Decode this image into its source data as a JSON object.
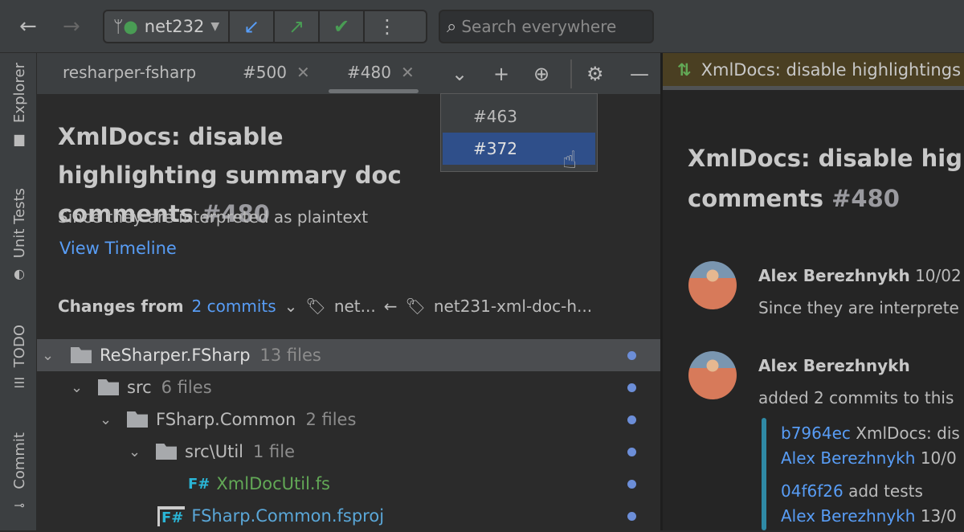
{
  "toolbar": {
    "branch": "net232",
    "search_placeholder": "Search everywhere"
  },
  "sidebar": {
    "items": [
      {
        "label": "Explorer"
      },
      {
        "label": "Unit Tests"
      },
      {
        "label": "TODO"
      },
      {
        "label": "Commit"
      }
    ]
  },
  "tabs": [
    {
      "label": "resharper-fsharp"
    },
    {
      "label": "#500"
    },
    {
      "label": "#480",
      "active": true
    }
  ],
  "dropdown": {
    "items": [
      {
        "label": "#463"
      },
      {
        "label": "#372",
        "selected": true
      }
    ]
  },
  "pr": {
    "title": "XmlDocs: disable highlighting summary doc comments",
    "number": "#480",
    "description": "Since they are interpreted as plaintext",
    "timeline_link": "View Timeline",
    "changes_label": "Changes from",
    "commits_link": "2 commits",
    "target_branch": "net...",
    "source_branch": "net231-xml-doc-h..."
  },
  "tree": [
    {
      "name": "ReSharper.FSharp",
      "count": "13 files",
      "depth": 0,
      "type": "folder"
    },
    {
      "name": "src",
      "count": "6 files",
      "depth": 1,
      "type": "folder"
    },
    {
      "name": "FSharp.Common",
      "count": "2 files",
      "depth": 2,
      "type": "folder"
    },
    {
      "name": "src\\Util",
      "count": "1 file",
      "depth": 3,
      "type": "folder"
    },
    {
      "name": "XmlDocUtil.fs",
      "count": "",
      "depth": 4,
      "type": "fs"
    },
    {
      "name": "FSharp.Common.fsproj",
      "count": "",
      "depth": 3,
      "type": "fsproj"
    }
  ],
  "right": {
    "tab_title": "XmlDocs: disable highlightings",
    "title_line1": "XmlDocs: disable high",
    "title_line2": "comments",
    "number": "#480",
    "timeline": [
      {
        "author": "Alex Berezhnykh",
        "date": "10/02",
        "text": "Since they are interprete"
      },
      {
        "author": "Alex Berezhnykh",
        "text": "added 2 commits to this"
      }
    ],
    "commits": [
      {
        "hash": "b7964ec",
        "message": "XmlDocs: dis",
        "author": "Alex Berezhnykh",
        "date": "10/0"
      },
      {
        "hash": "04f6f26",
        "message": "add tests",
        "author": "Alex Berezhnykh",
        "date": "13/0"
      }
    ]
  },
  "colors": {
    "accent": "#589df6",
    "selection": "#2f4f8a",
    "added": "#499c54"
  }
}
